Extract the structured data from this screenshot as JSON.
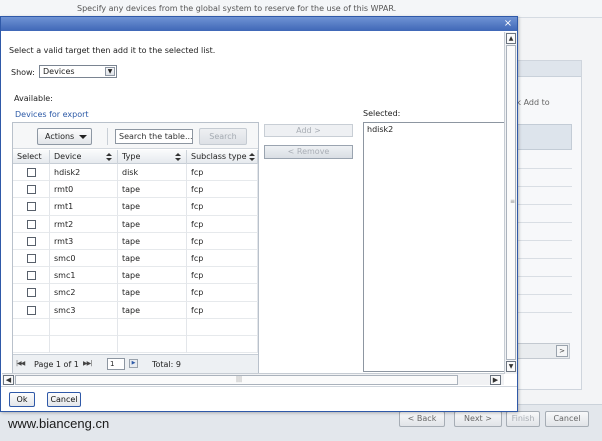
{
  "background": {
    "intro_text": "Specify any devices from the global system to reserve for the use of this WPAR.",
    "hint_text": "ck Add to",
    "buttons": {
      "back": "< Back",
      "next": "Next >",
      "finish": "Finish",
      "cancel": "Cancel"
    },
    "watermark": "www.bianceng.cn"
  },
  "dialog": {
    "close_label": "×",
    "instruction": "Select a valid target then add it to the selected list.",
    "show_label": "Show:",
    "show_value": "Devices",
    "available_label": "Available:",
    "devices_link": "Devices for export",
    "toolbar": {
      "actions_label": "Actions",
      "search_placeholder": "Search the table...",
      "search_button": "Search"
    },
    "table": {
      "columns": [
        "Select",
        "Device",
        "Type",
        "Subclass type"
      ],
      "rows": [
        {
          "device": "hdisk2",
          "type": "disk",
          "subclass": "fcp",
          "selected": false
        },
        {
          "device": "rmt0",
          "type": "tape",
          "subclass": "fcp",
          "selected": false
        },
        {
          "device": "rmt1",
          "type": "tape",
          "subclass": "fcp",
          "selected": false
        },
        {
          "device": "rmt2",
          "type": "tape",
          "subclass": "fcp",
          "selected": false
        },
        {
          "device": "rmt3",
          "type": "tape",
          "subclass": "fcp",
          "selected": false
        },
        {
          "device": "smc0",
          "type": "tape",
          "subclass": "fcp",
          "selected": false
        },
        {
          "device": "smc1",
          "type": "tape",
          "subclass": "fcp",
          "selected": false
        },
        {
          "device": "smc2",
          "type": "tape",
          "subclass": "fcp",
          "selected": false
        },
        {
          "device": "smc3",
          "type": "tape",
          "subclass": "fcp",
          "selected": false
        }
      ]
    },
    "pager": {
      "page_text": "Page 1 of 1",
      "page_input": "1",
      "total_text": "Total: 9"
    },
    "add_button": "Add >",
    "remove_button": "< Remove",
    "selected_label": "Selected:",
    "selected_items": [
      "hdisk2"
    ],
    "ok_button": "Ok",
    "cancel_button": "Cancel"
  },
  "colors": {
    "titlebar": "#3f67b7",
    "link": "#2d5aa7",
    "dialog_border": "#2f59a8"
  }
}
